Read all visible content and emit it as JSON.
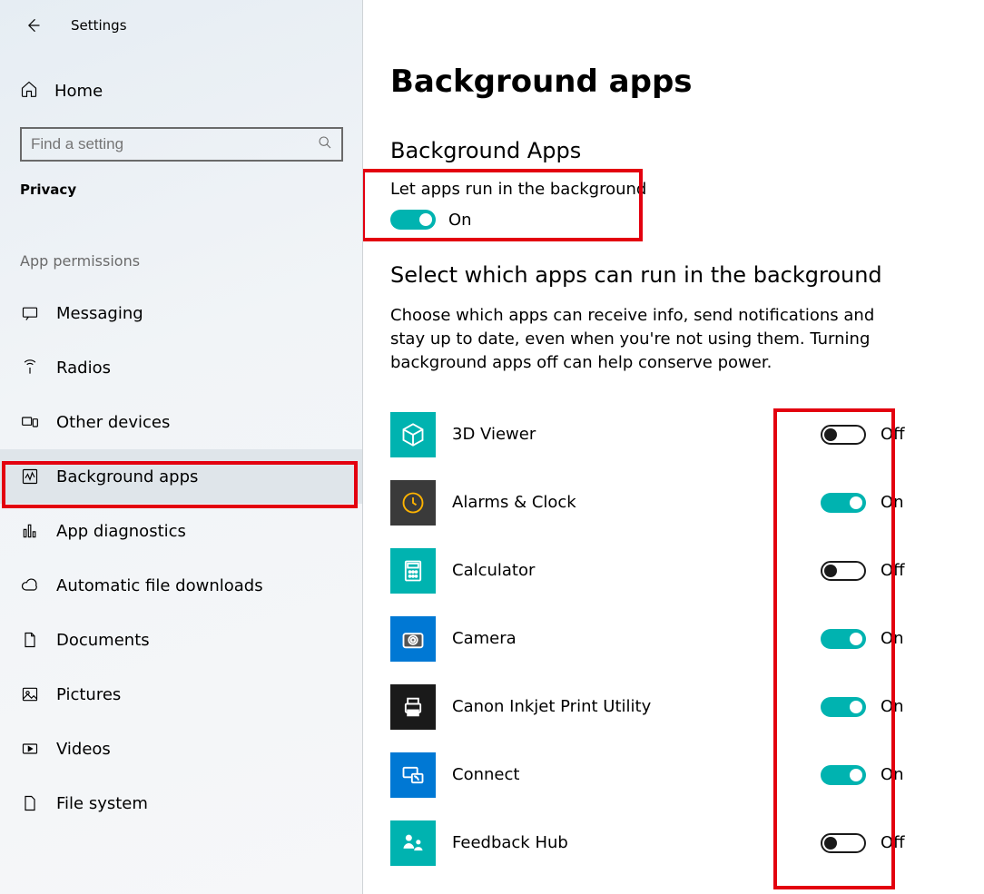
{
  "header": {
    "title": "Settings"
  },
  "sidebar": {
    "home": "Home",
    "search_placeholder": "Find a setting",
    "category": "Privacy",
    "group_label": "App permissions",
    "items": [
      {
        "label": "Messaging",
        "icon": "message-icon",
        "selected": false
      },
      {
        "label": "Radios",
        "icon": "radio-icon",
        "selected": false
      },
      {
        "label": "Other devices",
        "icon": "devices-icon",
        "selected": false
      },
      {
        "label": "Background apps",
        "icon": "activity-icon",
        "selected": true
      },
      {
        "label": "App diagnostics",
        "icon": "diag-icon",
        "selected": false
      },
      {
        "label": "Automatic file downloads",
        "icon": "cloud-icon",
        "selected": false
      },
      {
        "label": "Documents",
        "icon": "document-icon",
        "selected": false
      },
      {
        "label": "Pictures",
        "icon": "picture-icon",
        "selected": false
      },
      {
        "label": "Videos",
        "icon": "video-icon",
        "selected": false
      },
      {
        "label": "File system",
        "icon": "file-icon",
        "selected": false
      }
    ]
  },
  "main": {
    "page_title": "Background apps",
    "section1_title": "Background Apps",
    "master_label": "Let apps run in the background",
    "master_on": true,
    "master_state": "On",
    "section2_title": "Select which apps can run in the background",
    "description": "Choose which apps can receive info, send notifications and stay up to date, even when you're not using them. Turning background apps off can help conserve power.",
    "state_on": "On",
    "state_off": "Off",
    "apps": [
      {
        "name": "3D Viewer",
        "on": false,
        "bg": "#00b3b0",
        "icon": "cube-icon"
      },
      {
        "name": "Alarms & Clock",
        "on": true,
        "bg": "#3a3a3a",
        "icon": "clock-icon"
      },
      {
        "name": "Calculator",
        "on": false,
        "bg": "#00b3b0",
        "icon": "calc-icon"
      },
      {
        "name": "Camera",
        "on": true,
        "bg": "#0078d4",
        "icon": "camera-icon"
      },
      {
        "name": "Canon Inkjet Print Utility",
        "on": true,
        "bg": "#1a1a1a",
        "icon": "printer-icon"
      },
      {
        "name": "Connect",
        "on": true,
        "bg": "#0078d4",
        "icon": "connect-icon"
      },
      {
        "name": "Feedback Hub",
        "on": false,
        "bg": "#00b3b0",
        "icon": "feedback-icon"
      }
    ]
  },
  "colors": {
    "accent": "#00b3b0",
    "highlight": "#e3000f"
  }
}
